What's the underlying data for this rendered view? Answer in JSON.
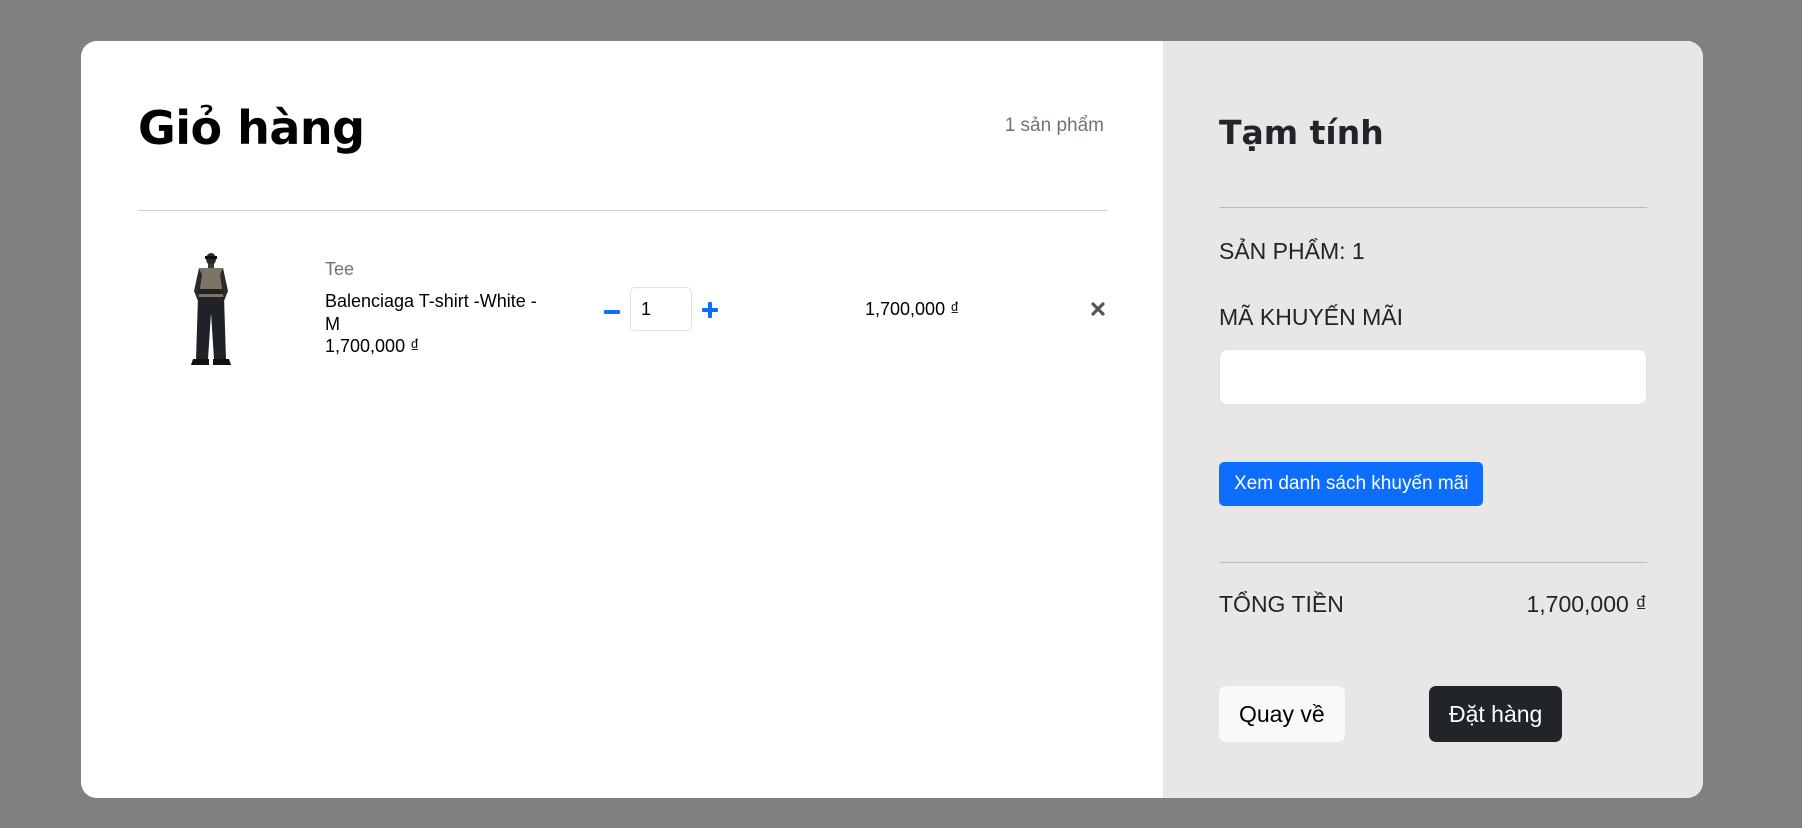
{
  "cart": {
    "title": "Giỏ hàng",
    "item_count_text": "1 sản phẩm",
    "items": [
      {
        "image_icon": "person-in-tshirt-photo",
        "category": "Tee",
        "name": "Balenciaga T-shirt -White - M",
        "price": "1,700,000 ₫",
        "quantity": "1",
        "line_total": "1,700,000 ₫"
      }
    ]
  },
  "summary": {
    "title": "Tạm tính",
    "item_count_label": "SẢN PHẨM: 1",
    "promo_label": "MÃ KHUYẾN MÃI",
    "promo_value": "",
    "promo_list_button": "Xem danh sách khuyến mãi",
    "total_label": "TỔNG TIỀN",
    "total_value": "1,700,000 ₫",
    "back_button": "Quay về",
    "order_button": "Đặt hàng"
  },
  "colors": {
    "overlay": "#808080",
    "summary_bg": "#e8e6e7",
    "primary": "#0d6efd",
    "dark": "#212529",
    "light": "#f8f9fa"
  }
}
